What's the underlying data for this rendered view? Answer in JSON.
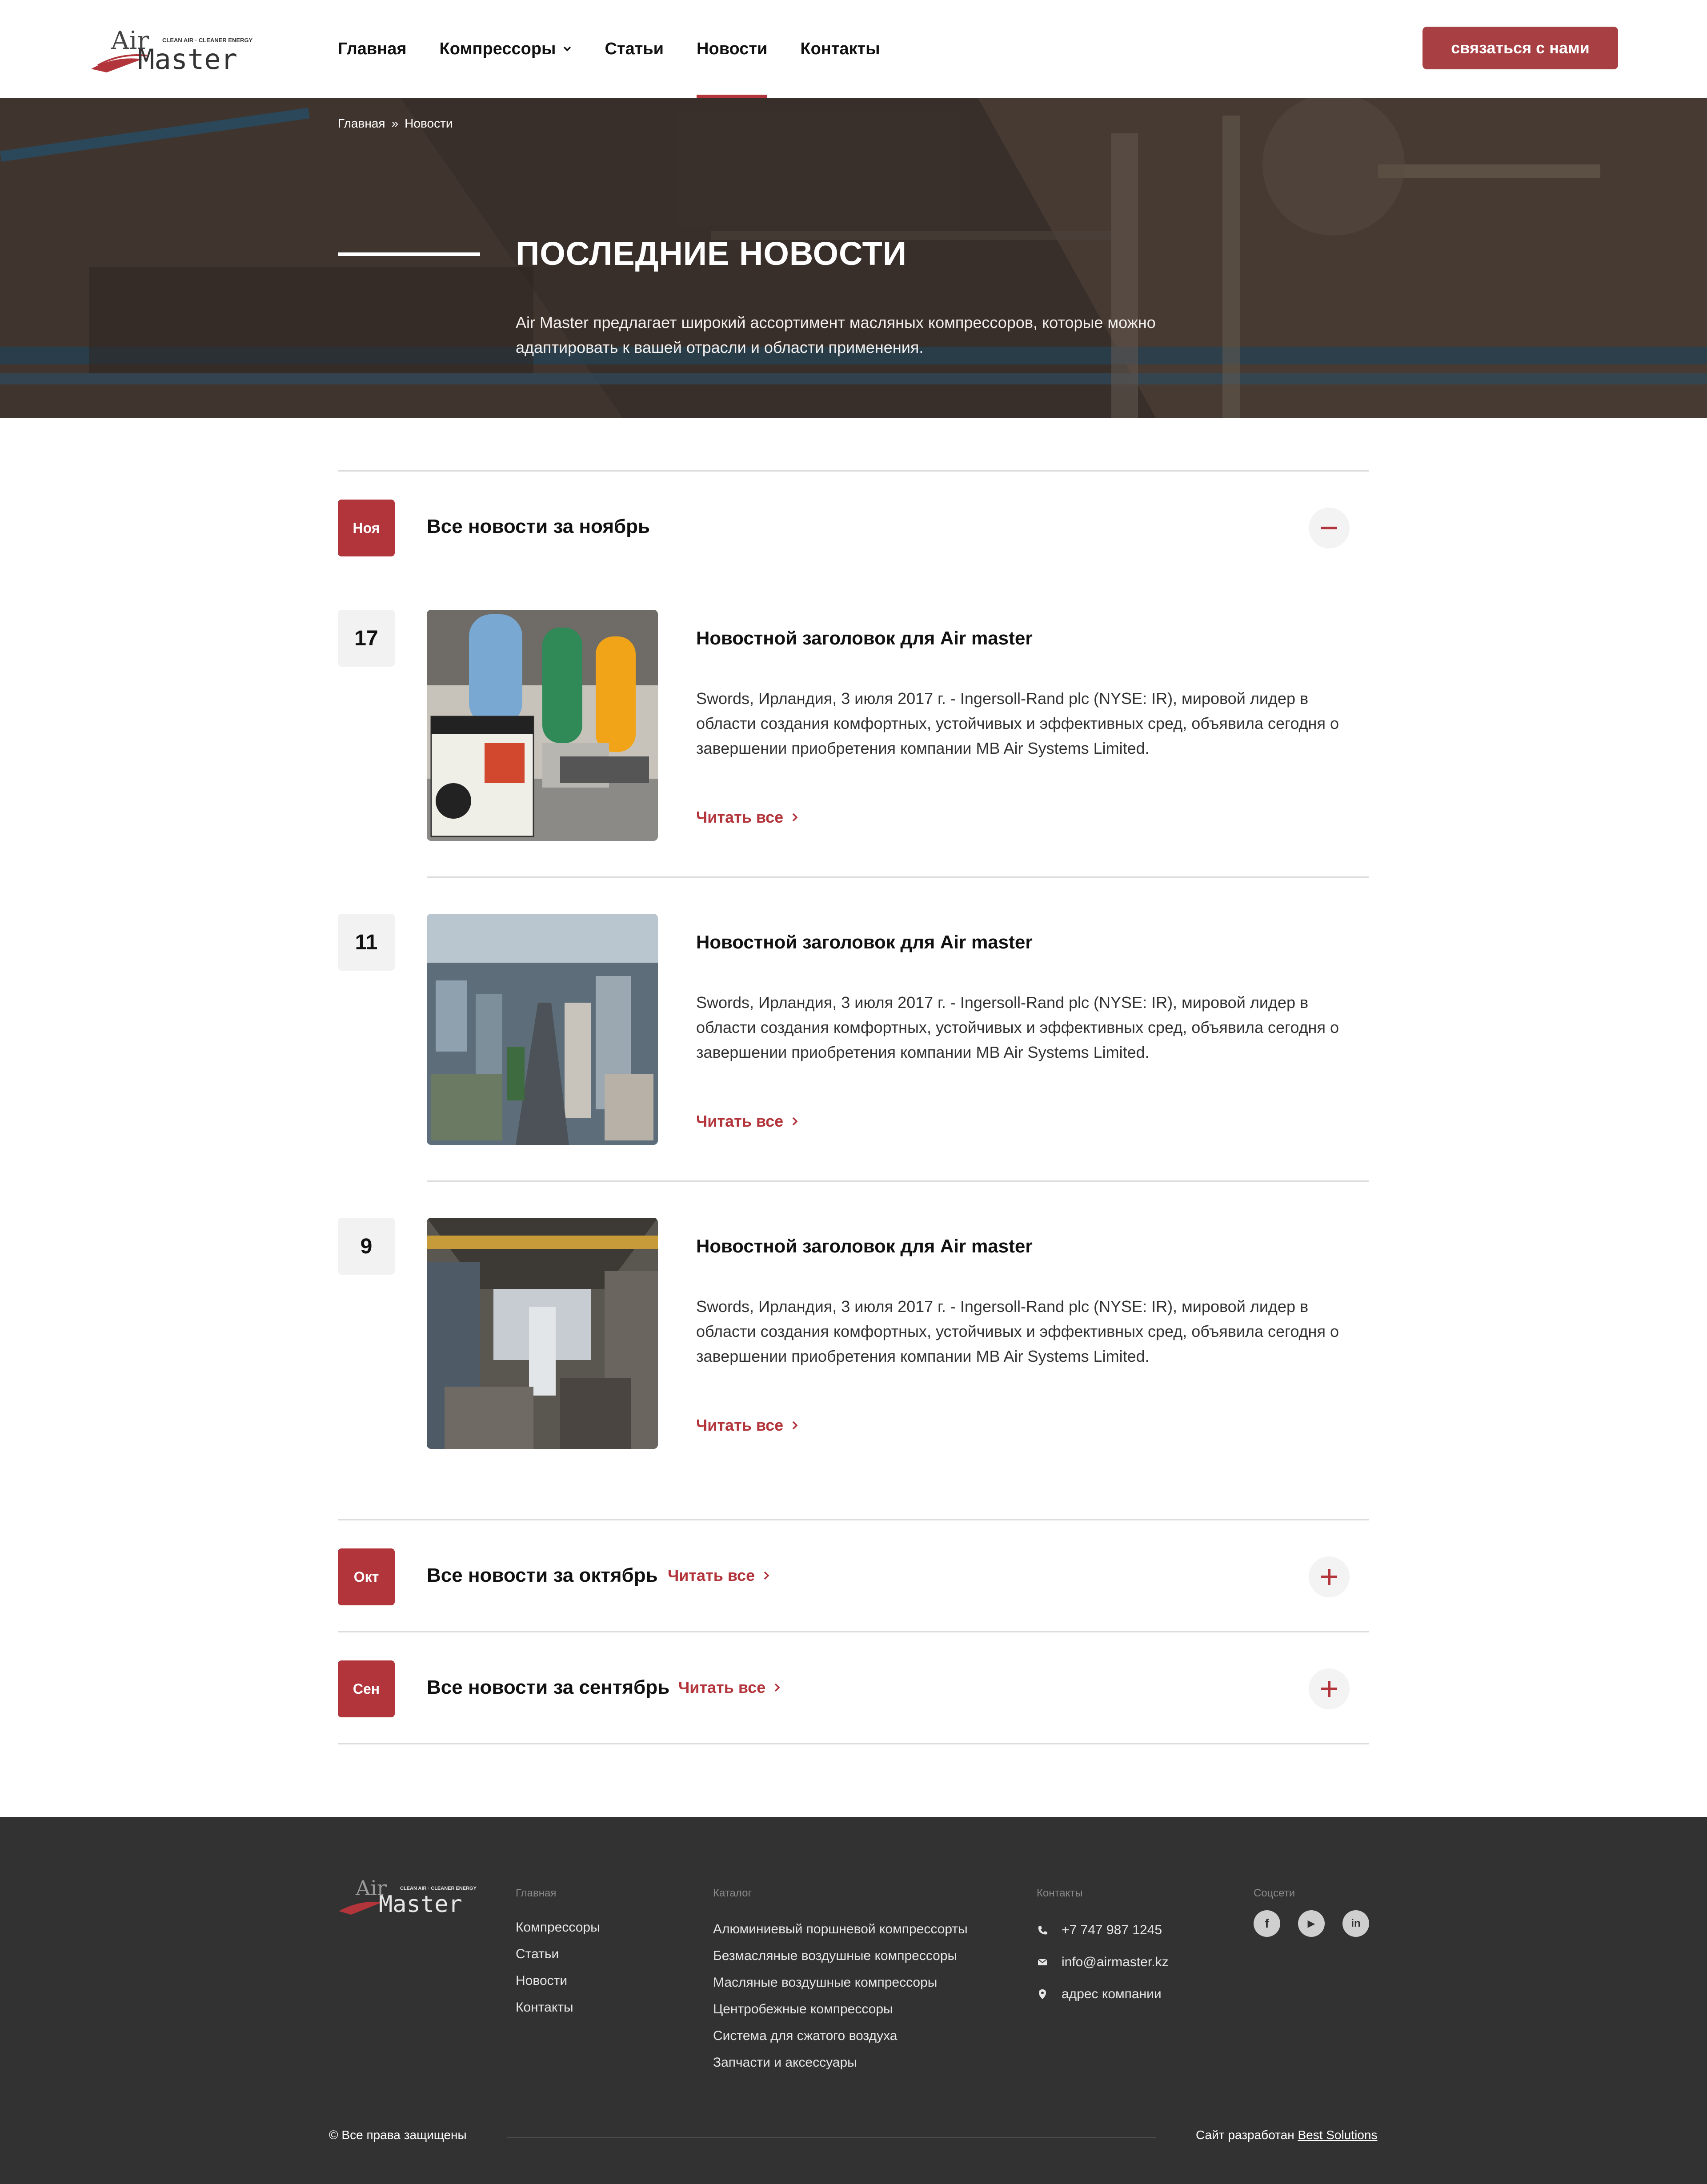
{
  "header": {
    "logo": {
      "air": "Air",
      "master": "Master",
      "tagline": "CLEAN AIR · CLEANER ENERGY"
    },
    "nav": [
      {
        "label": "Главная"
      },
      {
        "label": "Компрессоры"
      },
      {
        "label": "Статьи"
      },
      {
        "label": "Новости"
      },
      {
        "label": "Контакты"
      }
    ],
    "active_nav": "Новости",
    "cta_label": "связаться с нами"
  },
  "hero": {
    "breadcrumb": {
      "home": "Главная",
      "separator": "»",
      "current": "Новости"
    },
    "title": "ПОСЛЕДНИЕ НОВОСТИ",
    "subtitle": "Air Master предлагает широкий ассортимент масляных компрессоров, которые можно адаптировать к вашей отрасли и области применения."
  },
  "months": [
    {
      "badge": "Ноя",
      "title": "Все новости за ноябрь",
      "expanded": true,
      "read_all": ""
    },
    {
      "badge": "Окт",
      "title": "Все новости за октябрь",
      "expanded": false,
      "read_all": "Читать все"
    },
    {
      "badge": "Сен",
      "title": "Все новости за сентябрь",
      "expanded": false,
      "read_all": "Читать все"
    }
  ],
  "news": [
    {
      "day": "17",
      "image": "compressors-photo",
      "title": "Новостной заголовок для Air master",
      "text": "Swords, Ирландия, 3 июля 2017 г. - Ingersoll-Rand plc (NYSE: IR), мировой лидер в области создания комфортных, устойчивых и эффективных сред, объявила сегодня о завершении приобретения компании MB Air Systems Limited.",
      "link": "Читать все"
    },
    {
      "day": "11",
      "image": "city-photo",
      "title": "Новостной заголовок для Air master",
      "text": "Swords, Ирландия, 3 июля 2017 г. - Ingersoll-Rand plc (NYSE: IR), мировой лидер в области создания комфортных, устойчивых и эффективных сред, объявила сегодня о завершении приобретения компании MB Air Systems Limited.",
      "link": "Читать все"
    },
    {
      "day": "9",
      "image": "factory-photo",
      "title": "Новостной заголовок для Air master",
      "text": "Swords, Ирландия, 3 июля 2017 г. - Ingersoll-Rand plc (NYSE: IR), мировой лидер в области создания комфортных, устойчивых и эффективных сред, объявила сегодня о завершении приобретения компании MB Air Systems Limited.",
      "link": "Читать все"
    }
  ],
  "footer": {
    "col_main": {
      "heading": "Главная",
      "links": [
        "Компрессоры",
        "Статьи",
        "Новости",
        "Контакты"
      ]
    },
    "col_catalog": {
      "heading": "Каталог",
      "links": [
        "Алюминиевый поршневой компрессорты",
        "Безмасляные воздушные компрессоры",
        "Масляные воздушные компрессоры",
        "Центробежные компрессоры",
        "Система для сжатого воздуха",
        "Запчасти и аксессуары"
      ]
    },
    "col_contacts": {
      "heading": "Контакты",
      "phone": "+7 747 987 1245",
      "email": "info@airmaster.kz",
      "address": "адрес компании"
    },
    "col_social": {
      "heading": "Соцсети",
      "icons": [
        "facebook-icon",
        "youtube-icon",
        "linkedin-icon"
      ],
      "glyphs": [
        "f",
        "▶",
        "in"
      ]
    },
    "copyright": "© Все права защищены",
    "made_by_prefix": "Сайт разработан",
    "made_by_link": "Best Solutions"
  },
  "colors": {
    "accent": "#b3353c",
    "cta": "#a83f43",
    "footer_bg": "#323232"
  }
}
